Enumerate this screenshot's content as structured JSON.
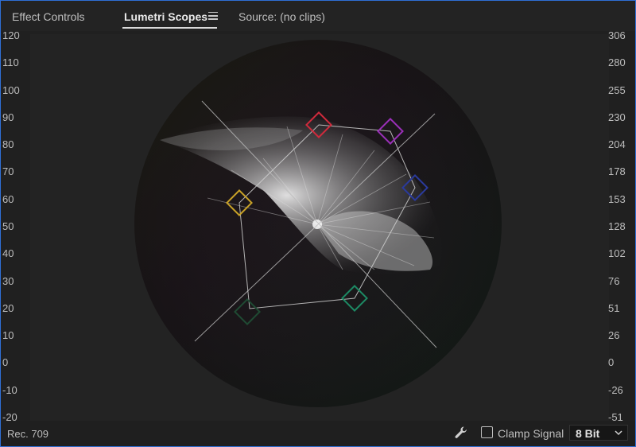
{
  "tabs": [
    {
      "label": "Effect Controls",
      "active": false
    },
    {
      "label": "Lumetri Scopes",
      "active": true
    },
    {
      "label": "Source: (no clips)",
      "active": false
    }
  ],
  "tab_menu_icon": "hamburger-menu-icon",
  "scope": {
    "left_ticks": [
      "120",
      "110",
      "100",
      "90",
      "80",
      "70",
      "60",
      "50",
      "40",
      "30",
      "20",
      "10",
      "0",
      "-10",
      "-20"
    ],
    "right_ticks": [
      "306",
      "280",
      "255",
      "230",
      "204",
      "178",
      "153",
      "128",
      "102",
      "76",
      "51",
      "26",
      "0",
      "-26",
      "-51"
    ],
    "targets": [
      {
        "name": "red",
        "color": "#d02a3c"
      },
      {
        "name": "magenta",
        "color": "#9a2fb8"
      },
      {
        "name": "blue",
        "color": "#2a3a9c"
      },
      {
        "name": "cyan",
        "color": "#1d8a64"
      },
      {
        "name": "green",
        "color": "#1f4a33"
      },
      {
        "name": "yellow",
        "color": "#c9a227"
      }
    ]
  },
  "footer": {
    "colorspace": "Rec. 709",
    "wrench_icon": "wrench-icon",
    "clamp_label": "Clamp Signal",
    "clamp_checked": false,
    "bit_depth": "8 Bit"
  },
  "colors": {
    "accent_border": "#2f6fd6"
  }
}
